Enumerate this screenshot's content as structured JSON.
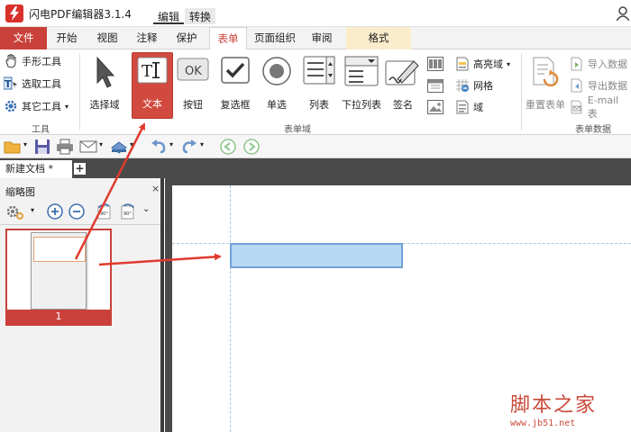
{
  "app": {
    "title": "闪电PDF编辑器3.1.4",
    "top_tabs": [
      "编辑",
      "转换"
    ]
  },
  "ribbon_tabs": [
    {
      "label": "文件"
    },
    {
      "label": "开始"
    },
    {
      "label": "视图"
    },
    {
      "label": "注释"
    },
    {
      "label": "保护"
    },
    {
      "label": "表单"
    },
    {
      "label": "页面组织"
    },
    {
      "label": "审阅"
    },
    {
      "label": "格式"
    }
  ],
  "tools_group": {
    "items": [
      "手形工具",
      "选取工具",
      "其它工具"
    ],
    "label": "工具"
  },
  "form_fields_group": {
    "buttons": [
      "选择域",
      "文本",
      "按钮",
      "复选框",
      "单选",
      "列表",
      "下拉列表",
      "签名"
    ],
    "small_items": [
      "高亮域",
      "网格",
      "域"
    ],
    "label": "表单域"
  },
  "form_data_group": {
    "reset_label": "重置表单",
    "items": [
      "导入数据",
      "导出数据",
      "E-mail 表"
    ],
    "label": "表单数据"
  },
  "ok_button_text": "OK",
  "document": {
    "tab_label": "新建文档 *",
    "add_tab": "+"
  },
  "thumbnail_panel": {
    "title": "缩略图",
    "close": "×",
    "page_number": "1"
  },
  "watermark": {
    "text": "脚本之家",
    "url": "www.jb51.net"
  },
  "colors": {
    "accent": "#c9413a",
    "field_fill": "#b8d7f2",
    "arrow": "#e03a2e"
  }
}
